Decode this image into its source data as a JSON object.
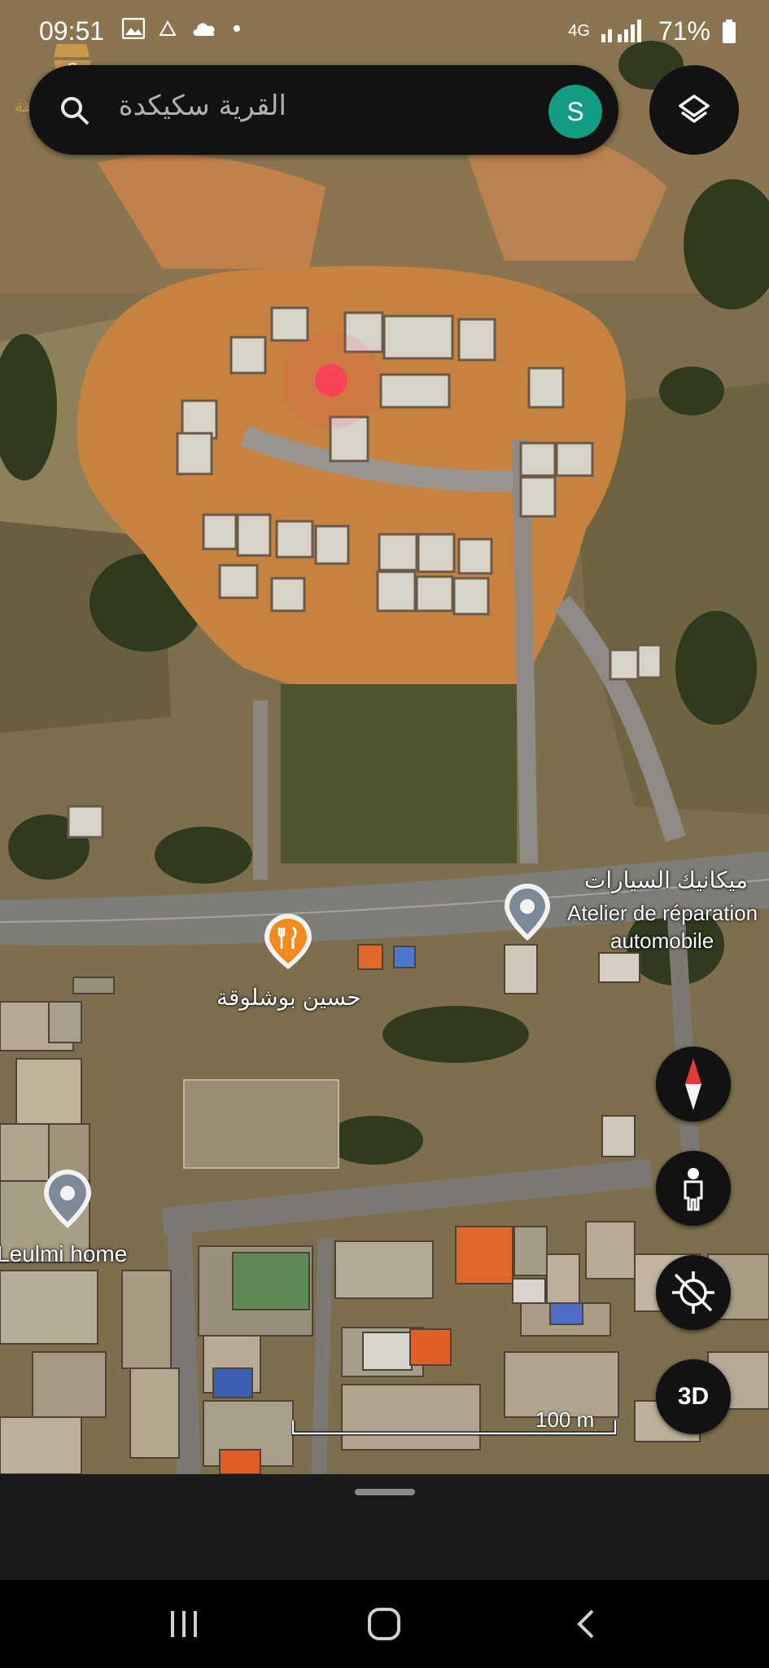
{
  "status": {
    "time": "09:51",
    "network": "4G",
    "battery": "71%"
  },
  "search": {
    "text": "القرية سكيكدة",
    "avatar_letter": "S"
  },
  "watermark": {
    "text": "سويقة"
  },
  "places": [
    {
      "label_ar": "ميكانيك السيارات",
      "label_fr_1": "Atelier de réparation",
      "label_fr_2": "automobile",
      "type": "pin-gray"
    },
    {
      "label": "حسين بوشلوقة",
      "type": "restaurant",
      "color": "#f28b1f"
    },
    {
      "label": "Leulmi home",
      "type": "pin-gray"
    }
  ],
  "controls": {
    "compass_icon": "compass-icon",
    "pegman_icon": "pegman-icon",
    "location_icon": "location-off-icon",
    "three_d_label": "3D"
  },
  "scale": {
    "label": "100 m"
  },
  "colors": {
    "avatar_bg": "#159b84",
    "restaurant_pin": "#f28b1f",
    "selected_marker": "#ff3b5c"
  },
  "nav": {
    "recents_icon": "recents-icon",
    "home_icon": "home-icon",
    "back_icon": "back-icon"
  }
}
